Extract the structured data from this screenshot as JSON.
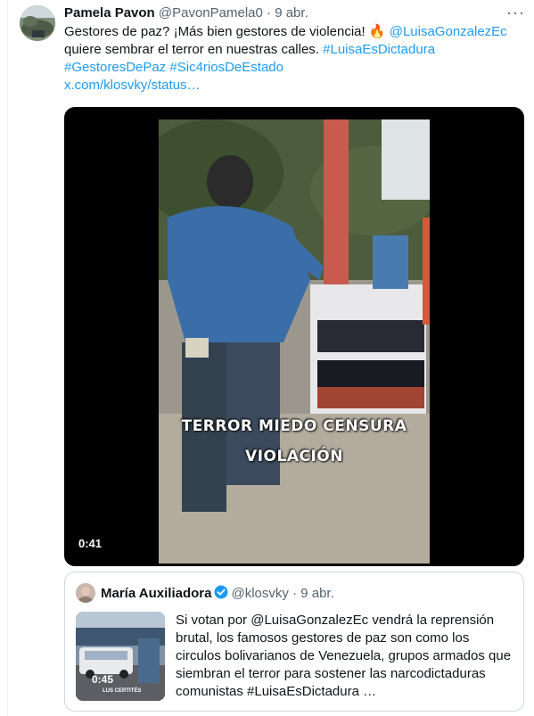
{
  "tweet": {
    "author_name": "Pamela Pavon",
    "author_handle": "@PavonPamela0",
    "separator": "·",
    "date": "9 abr.",
    "more_icon": "more-horizontal-icon",
    "text_part1": "Gestores de paz? ¡Más bien gestores de violencia! ",
    "emoji": "🔥",
    "mention": "@LuisaGonzalezEc",
    "text_part2": " quiere sembrar el terror en nuestras calles. ",
    "hashtag1": "#LuisaEsDictadura",
    "hashtag2": "#GestoresDePaz",
    "hashtag3": "#Sic4riosDeEstado",
    "url": "x.com/klosvky/status…"
  },
  "video": {
    "caption_line1": "TERROR MIEDO CENSURA",
    "caption_line2": "VIOLACIÓN",
    "duration": "0:41"
  },
  "quoted_tweet": {
    "author_name": "María Auxiliadora",
    "author_handle": "@klosvky",
    "separator": "·",
    "date": "9 abr.",
    "verified_icon": "verified-badge-icon",
    "thumb_duration": "0:45",
    "thumb_caption": "LUS CERTITÉS",
    "text": "Si votan por @LuisaGonzalezEc vendrá la reprensión brutal, los famosos gestores de paz son como los circulos bolivarianos de Venezuela, grupos armados que siembran el terror para sostener las narcodictaduras comunistas #LuisaEsDictadura …"
  },
  "colors": {
    "link": "#1d9bf0",
    "muted": "#536471",
    "text": "#0f1419",
    "border": "#cfd9de"
  }
}
